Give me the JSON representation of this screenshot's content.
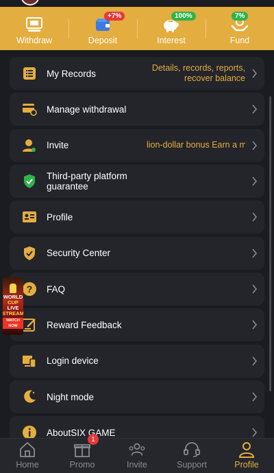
{
  "top_actions": [
    {
      "label": "Withdraw",
      "icon": "withdraw-icon",
      "badge": ""
    },
    {
      "label": "Deposit",
      "icon": "wallet-icon",
      "badge": "+7%",
      "badge_color": "#e5383b"
    },
    {
      "label": "Interest",
      "icon": "piggy-bank-icon",
      "badge": "100%",
      "badge_color": "#2fb34a"
    },
    {
      "label": "Fund",
      "icon": "fund-hands-icon",
      "badge": "7%",
      "badge_color": "#2fb34a"
    }
  ],
  "menu": [
    {
      "label": "My Records",
      "hint": "Details, records, reports, recover balance",
      "icon": "records-list-icon"
    },
    {
      "label": "Manage withdrawal",
      "icon": "card-settings-icon"
    },
    {
      "label": "Invite",
      "hint": "lion-dollar bonus  Earn a m",
      "icon": "invite-user-icon"
    },
    {
      "label": "Third-party platform guarantee",
      "icon": "shield-check-icon"
    },
    {
      "label": "Profile",
      "icon": "id-card-icon"
    },
    {
      "label": "Security Center",
      "icon": "security-shield-icon"
    },
    {
      "label": "FAQ",
      "icon": "question-icon"
    },
    {
      "label": "Reward Feedback",
      "icon": "feedback-edit-icon"
    },
    {
      "label": "Login device",
      "icon": "devices-icon"
    },
    {
      "label": "Night mode",
      "icon": "moon-icon"
    },
    {
      "label": "AboutSIX GAME",
      "icon": "info-icon"
    }
  ],
  "promo": {
    "line1": "WORLD",
    "line2": "CUP",
    "line3": "LIVE",
    "line4": "STREAM",
    "cta": "WATCH NOW"
  },
  "bottom_nav": [
    {
      "label": "Home",
      "icon": "home-icon",
      "active": false
    },
    {
      "label": "Promo",
      "icon": "gift-icon",
      "active": false,
      "badge": "1"
    },
    {
      "label": "Invite",
      "icon": "invite-people-icon",
      "active": false
    },
    {
      "label": "Support",
      "icon": "headset-icon",
      "active": false
    },
    {
      "label": "Profile",
      "icon": "profile-icon",
      "active": true
    }
  ],
  "colors": {
    "accent": "#e4ad3f",
    "background": "#1b1c21",
    "row": "#24252b",
    "nav_inactive": "#8a8b92"
  }
}
